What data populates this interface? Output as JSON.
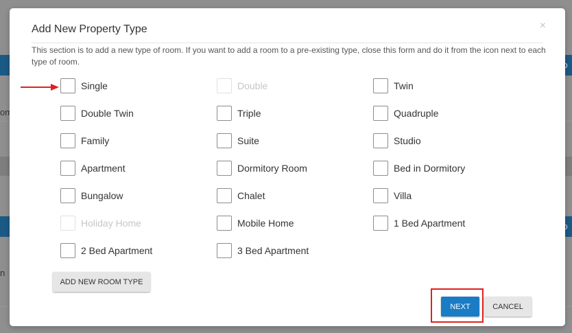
{
  "modal": {
    "title": "Add New Property Type",
    "close_symbol": "×",
    "description": "This section is to add a new type of room. If you want to add a room to a pre-existing type, close this form and do it from the icon next to each type of room."
  },
  "background": {
    "text_fragments": [
      "om",
      "n"
    ],
    "button_fragments": [
      "To",
      "To"
    ]
  },
  "room_types": [
    {
      "label": "Single",
      "checked": false,
      "disabled": false
    },
    {
      "label": "Double",
      "checked": false,
      "disabled": true
    },
    {
      "label": "Twin",
      "checked": false,
      "disabled": false
    },
    {
      "label": "Double Twin",
      "checked": false,
      "disabled": false
    },
    {
      "label": "Triple",
      "checked": false,
      "disabled": false
    },
    {
      "label": "Quadruple",
      "checked": false,
      "disabled": false
    },
    {
      "label": "Family",
      "checked": false,
      "disabled": false
    },
    {
      "label": "Suite",
      "checked": false,
      "disabled": false
    },
    {
      "label": "Studio",
      "checked": false,
      "disabled": false
    },
    {
      "label": "Apartment",
      "checked": false,
      "disabled": false
    },
    {
      "label": "Dormitory Room",
      "checked": false,
      "disabled": false
    },
    {
      "label": "Bed in Dormitory",
      "checked": false,
      "disabled": false
    },
    {
      "label": "Bungalow",
      "checked": false,
      "disabled": false
    },
    {
      "label": "Chalet",
      "checked": false,
      "disabled": false
    },
    {
      "label": "Villa",
      "checked": false,
      "disabled": false
    },
    {
      "label": "Holiday Home",
      "checked": false,
      "disabled": true
    },
    {
      "label": "Mobile Home",
      "checked": false,
      "disabled": false
    },
    {
      "label": "1 Bed Apartment",
      "checked": false,
      "disabled": false
    },
    {
      "label": "2 Bed Apartment",
      "checked": false,
      "disabled": false
    },
    {
      "label": "3 Bed Apartment",
      "checked": false,
      "disabled": false
    }
  ],
  "buttons": {
    "add_room_type": "ADD NEW ROOM TYPE",
    "next": "NEXT",
    "cancel": "CANCEL"
  },
  "colors": {
    "primary": "#1a7cc4",
    "annotation": "#e02020",
    "overlay": "#8f8f8f"
  }
}
